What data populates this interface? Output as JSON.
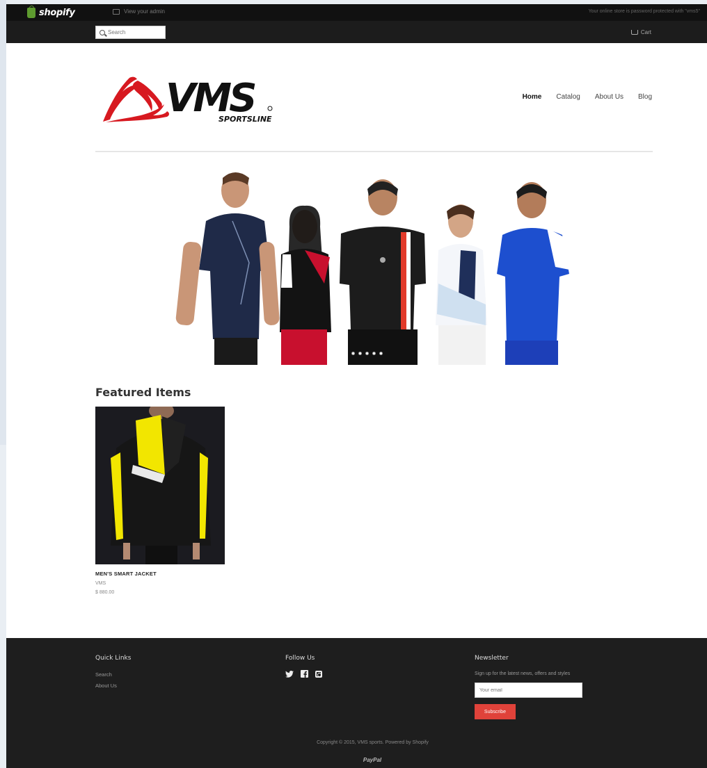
{
  "admin_bar": {
    "brand": "shopify",
    "view_admin": "View your admin",
    "notice": "Your online store is password protected with \"vms5\""
  },
  "top_bar": {
    "search_placeholder": "Search",
    "cart_label": "Cart"
  },
  "header": {
    "logo_main": "VMS",
    "logo_sub": "SPORTSLINE",
    "nav": [
      "Home",
      "Catalog",
      "About Us",
      "Blog"
    ],
    "active_nav": "Home"
  },
  "hero": {
    "slides": 5
  },
  "featured": {
    "title": "Featured Items",
    "product": {
      "title": "MEN'S SMART JACKET",
      "vendor": "VMS",
      "price": "$ 880.00"
    }
  },
  "footer": {
    "quick_links_title": "Quick Links",
    "quick_links": [
      "Search",
      "About Us"
    ],
    "follow_title": "Follow Us",
    "social_icons": [
      "twitter-icon",
      "facebook-icon",
      "instagram-icon"
    ],
    "newsletter_title": "Newsletter",
    "newsletter_text": "Sign up for the latest news, offers and styles",
    "email_placeholder": "Your email",
    "subscribe_label": "Subscribe",
    "copyright": "Copyright © 2015, VMS sports. Powered by Shopify",
    "payment": "PayPal"
  },
  "colors": {
    "admin_bar": "#111111",
    "top_bar": "#1c1c1c",
    "footer": "#1e1e1e",
    "subscribe": "#e0423a",
    "logo_red": "#d71920"
  }
}
